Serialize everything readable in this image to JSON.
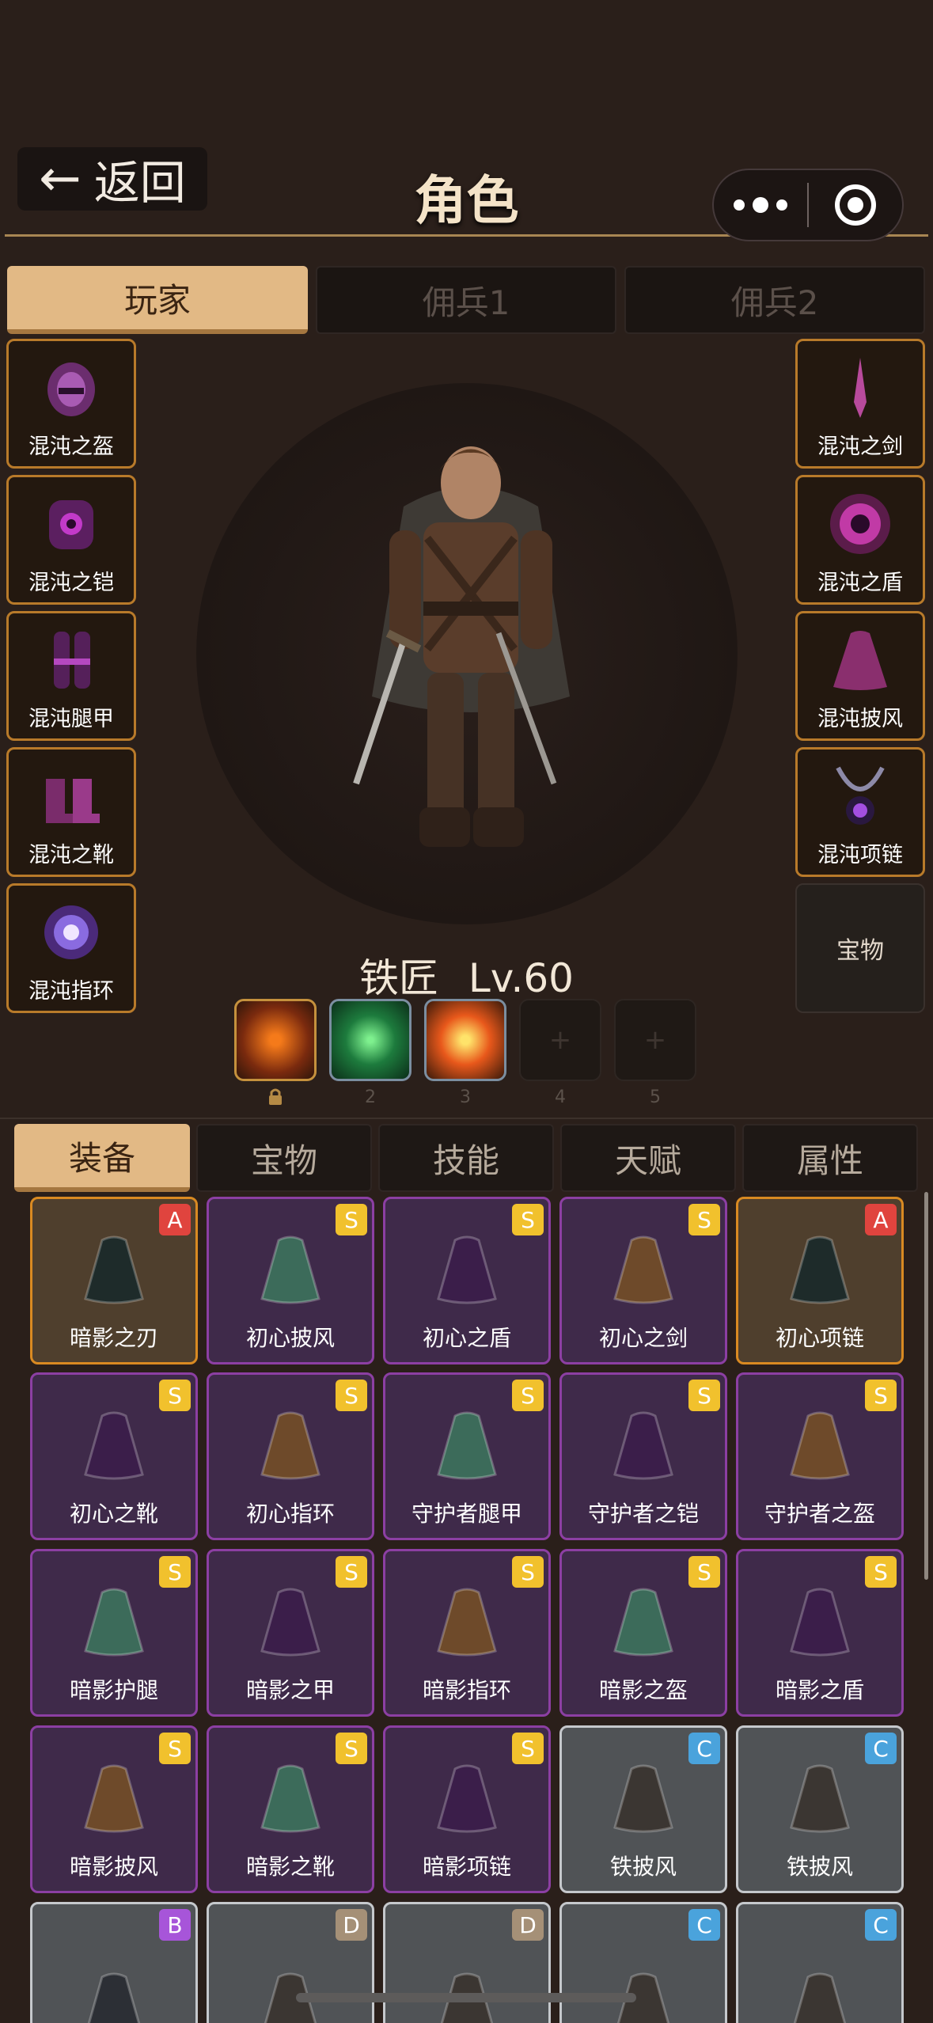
{
  "header": {
    "back_arrow": "←",
    "back_label": "返回",
    "title": "角色"
  },
  "char_tabs": [
    "玩家",
    "佣兵1",
    "佣兵2"
  ],
  "left_slots": [
    "混沌之盔",
    "混沌之铠",
    "混沌腿甲",
    "混沌之靴",
    "混沌指环"
  ],
  "right_slots": [
    "混沌之剑",
    "混沌之盾",
    "混沌披风",
    "混沌项链",
    "宝物"
  ],
  "hero": {
    "name": "铁匠",
    "level": "Lv.60"
  },
  "skills": [
    {
      "label": "",
      "icon": "shield-fire-skill-icon"
    },
    {
      "label": "2",
      "icon": "green-rune-skill-icon"
    },
    {
      "label": "3",
      "icon": "explosion-skill-icon"
    },
    {
      "label": "4",
      "icon": "plus-icon",
      "glyph": "+"
    },
    {
      "label": "5",
      "icon": "plus-icon",
      "glyph": "+"
    }
  ],
  "bottom_tabs": [
    "装备",
    "宝物",
    "技能",
    "天赋",
    "属性"
  ],
  "inventory": [
    {
      "name": "暗影之刃",
      "grade": "A"
    },
    {
      "name": "初心披风",
      "grade": "S"
    },
    {
      "name": "初心之盾",
      "grade": "S"
    },
    {
      "name": "初心之剑",
      "grade": "S"
    },
    {
      "name": "初心项链",
      "grade": "A"
    },
    {
      "name": "初心之靴",
      "grade": "S"
    },
    {
      "name": "初心指环",
      "grade": "S"
    },
    {
      "name": "守护者腿甲",
      "grade": "S"
    },
    {
      "name": "守护者之铠",
      "grade": "S"
    },
    {
      "name": "守护者之盔",
      "grade": "S"
    },
    {
      "name": "暗影护腿",
      "grade": "S"
    },
    {
      "name": "暗影之甲",
      "grade": "S"
    },
    {
      "name": "暗影指环",
      "grade": "S"
    },
    {
      "name": "暗影之盔",
      "grade": "S"
    },
    {
      "name": "暗影之盾",
      "grade": "S"
    },
    {
      "name": "暗影披风",
      "grade": "S"
    },
    {
      "name": "暗影之靴",
      "grade": "S"
    },
    {
      "name": "暗影项链",
      "grade": "S"
    },
    {
      "name": "铁披风",
      "grade": "C"
    },
    {
      "name": "铁披风",
      "grade": "C"
    },
    {
      "name": "",
      "grade": "B"
    },
    {
      "name": "",
      "grade": "D"
    },
    {
      "name": "",
      "grade": "D"
    },
    {
      "name": "",
      "grade": "C"
    },
    {
      "name": "",
      "grade": "C"
    }
  ],
  "colors": {
    "background": "#2a1f1a",
    "accent": "#e2b985",
    "grade_S": "#f1c12d",
    "grade_A": "#e0443e",
    "grade_B": "#a755d9",
    "grade_C": "#4aa3dc",
    "grade_D": "#a59077"
  }
}
